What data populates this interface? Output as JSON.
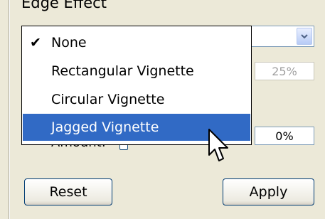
{
  "group": {
    "title": "Edge Effect"
  },
  "combo": {
    "arrow_icon": "chevron-down-icon"
  },
  "dropdown": {
    "options": [
      {
        "label": "None",
        "checked": true
      },
      {
        "label": "Rectangular Vignette",
        "checked": false
      },
      {
        "label": "Circular Vignette",
        "checked": false
      },
      {
        "label": "Jagged Vignette",
        "checked": false,
        "highlighted": true
      }
    ],
    "check_glyph": "✔"
  },
  "fields": {
    "size_value": "25%",
    "amount_label": "Amount:",
    "amount_value": "0%"
  },
  "buttons": {
    "reset": "Reset",
    "apply": "Apply"
  },
  "colors": {
    "highlight": "#316ac5",
    "face": "#ece9d8",
    "border": "#7f9db9"
  }
}
